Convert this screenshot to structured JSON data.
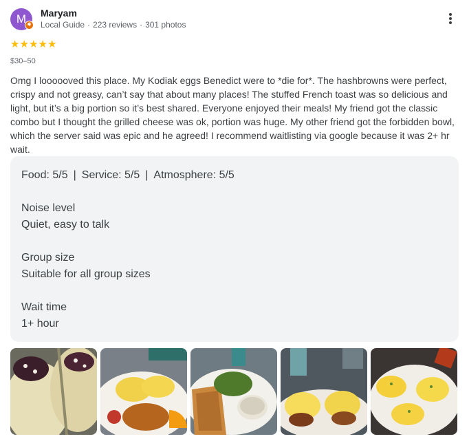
{
  "review": {
    "author": {
      "initial": "M",
      "name": "Maryam",
      "badge": "Local Guide",
      "reviews": "223 reviews",
      "photos": "301 photos",
      "avatar_color": "#8e57cf",
      "badge_color": "#e8710a"
    },
    "rating": {
      "value": 5,
      "max": 5,
      "glyph": "★",
      "color": "#fbbc04"
    },
    "price": "$30–50",
    "text": "Omg I loooooved this place. My Kodiak eggs Benedict were to *die for*. The hashbrowns were perfect, crispy and not greasy, can’t say that about many places! The stuffed French toast was so delicious and light, but it’s a big portion so it’s best shared. Everyone enjoyed their meals! My friend got the classic combo but I thought the grilled cheese was ok, portion was huge. My other friend got the forbidden bowl, which the server said was epic and he agreed! I recommend waitlisting via google because it was 2+ hr wait.",
    "scores": {
      "food": "Food: 5/5",
      "service": "Service: 5/5",
      "atmosphere": "Atmosphere: 5/5",
      "separator": "|"
    },
    "attributes": [
      {
        "label": "Noise level",
        "value": "Quiet, easy to talk"
      },
      {
        "label": "Group size",
        "value": "Suitable for all group sizes"
      },
      {
        "label": "Wait time",
        "value": "1+ hour"
      }
    ],
    "photos": [
      {
        "subject": "stuffed-french-toast"
      },
      {
        "subject": "eggs-benedict-hashbrowns"
      },
      {
        "subject": "grilled-cheese-salad"
      },
      {
        "subject": "eggs-benedict-closeup"
      },
      {
        "subject": "eggs-benedict-plate"
      }
    ],
    "icons": {
      "more": "more-vert-icon",
      "guide": "local-guide-badge-icon",
      "star": "star-icon"
    }
  }
}
